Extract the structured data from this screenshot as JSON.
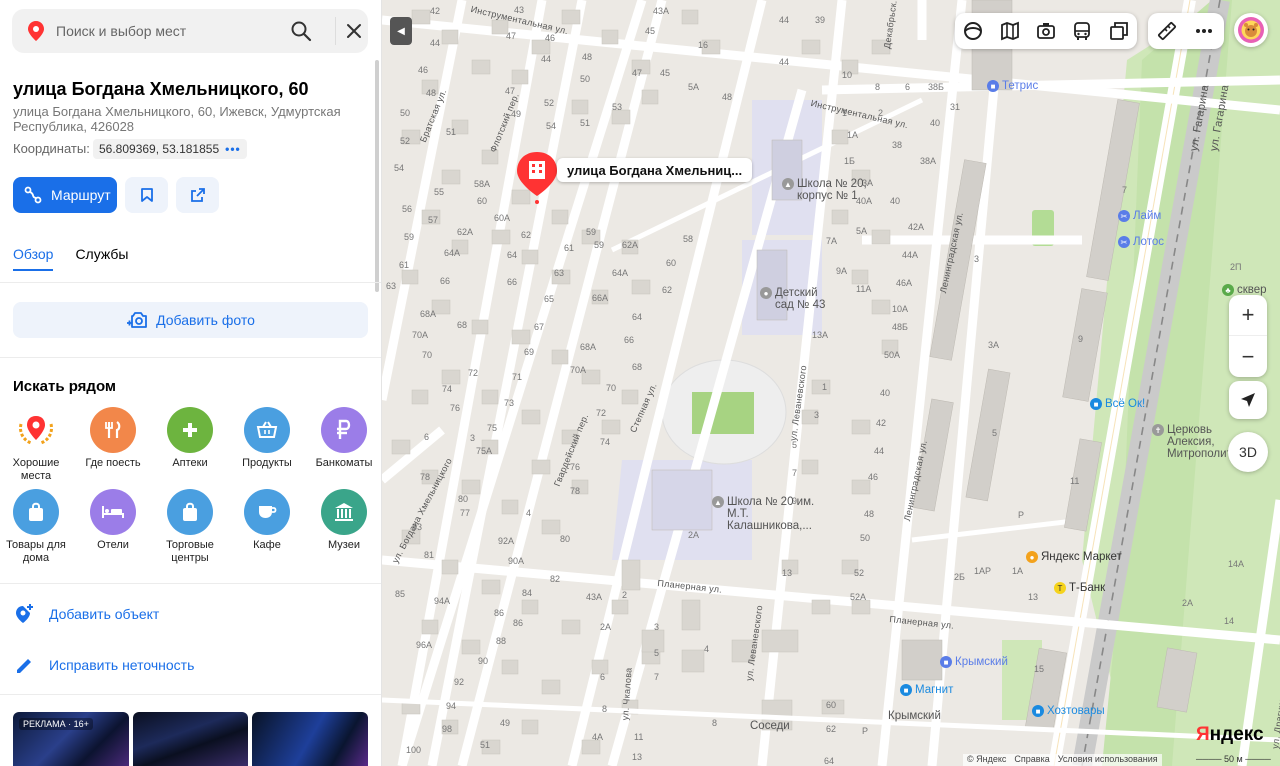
{
  "search": {
    "placeholder": "Поиск и выбор мест"
  },
  "place": {
    "title": "улица Богдана Хмельницкого, 60",
    "address": "улица Богдана Хмельницкого, 60, Ижевск, Удмуртская Республика, 426028",
    "coords_label": "Координаты:",
    "coords_value": "56.809369, 53.181855",
    "coords_more": "•••"
  },
  "actions": {
    "route_label": "Маршрут"
  },
  "tabs": [
    {
      "label": "Обзор",
      "active": true
    },
    {
      "label": "Службы",
      "active": false
    }
  ],
  "add_photo_label": "Добавить фото",
  "nearby": {
    "heading": "Искать рядом",
    "items": [
      {
        "label": "Хорошие места",
        "icon": "laurel-pin-icon",
        "color": "#ffffff"
      },
      {
        "label": "Где поесть",
        "icon": "fork-knife-icon",
        "color": "#f2874a"
      },
      {
        "label": "Аптеки",
        "icon": "plus-cross-icon",
        "color": "#6db43f"
      },
      {
        "label": "Продукты",
        "icon": "basket-icon",
        "color": "#4a9fe0"
      },
      {
        "label": "Банкоматы",
        "icon": "ruble-icon",
        "color": "#9b7de8"
      },
      {
        "label": "Товары для дома",
        "icon": "shopping-bag-icon",
        "color": "#4a9fe0"
      },
      {
        "label": "Отели",
        "icon": "bed-icon",
        "color": "#9b7de8"
      },
      {
        "label": "Торговые центры",
        "icon": "shopping-bag-icon",
        "color": "#4a9fe0"
      },
      {
        "label": "Кафе",
        "icon": "cup-icon",
        "color": "#4a9fe0"
      },
      {
        "label": "Музеи",
        "icon": "museum-icon",
        "color": "#3aa58a"
      }
    ]
  },
  "links": {
    "add_object": "Добавить объект",
    "fix_error": "Исправить неточность"
  },
  "ad": {
    "tag": "РЕКЛАМА · 16+"
  },
  "map": {
    "marker_label": "улица Богдана Хмельниц...",
    "zoom_in": "+",
    "zoom_out": "−",
    "btn_3d": "3D",
    "logo_main": "Я",
    "logo_rest": "ндекс",
    "footer": [
      "© Яндекс",
      "Справка",
      "Условия использования"
    ],
    "scale": "50 м",
    "pois": [
      {
        "name": "Тетрис",
        "color": "#5a7de8"
      },
      {
        "name": "Школа № 20, корпус № 1"
      },
      {
        "name": "Детский сад № 43"
      },
      {
        "name": "Школа № 20 им. М.Т. Калашникова,..."
      },
      {
        "name": "Лайм",
        "color": "#5a7de8"
      },
      {
        "name": "Лотос",
        "color": "#5a7de8"
      },
      {
        "name": "Всё Ок!",
        "color": "#1a8ae0"
      },
      {
        "name": "Церковь Алексия, Митрополита..."
      },
      {
        "name": "сквер А.Л. Т..."
      },
      {
        "name": "Яндекс Маркет",
        "color": "#f3a21c"
      },
      {
        "name": "Т-Банк",
        "color": "#f5d31c"
      },
      {
        "name": "Крымский",
        "color": "#5a7de8"
      },
      {
        "name": "Магнит",
        "color": "#1a8ae0"
      },
      {
        "name": "Хозтовары",
        "color": "#1a8ae0"
      },
      {
        "name": "Соседи"
      },
      {
        "name": "Крымский"
      }
    ],
    "streets": [
      "Инструментальная ул.",
      "Инструментальная ул.",
      "Братская ул.",
      "Флотский пер.",
      "Гвардейский пер.",
      "Степная ул.",
      "ул. Леваневского",
      "ул. Леваневского",
      "Ленинградская ул.",
      "Ленинградская ул.",
      "ул. Богдана Хмельницкого",
      "Планерная ул.",
      "Планерная ул.",
      "ул. Чкалова",
      "ул. Гагарина",
      "ул. Гагарина",
      "Декабрьск...",
      "ул. Драгунов..."
    ]
  }
}
